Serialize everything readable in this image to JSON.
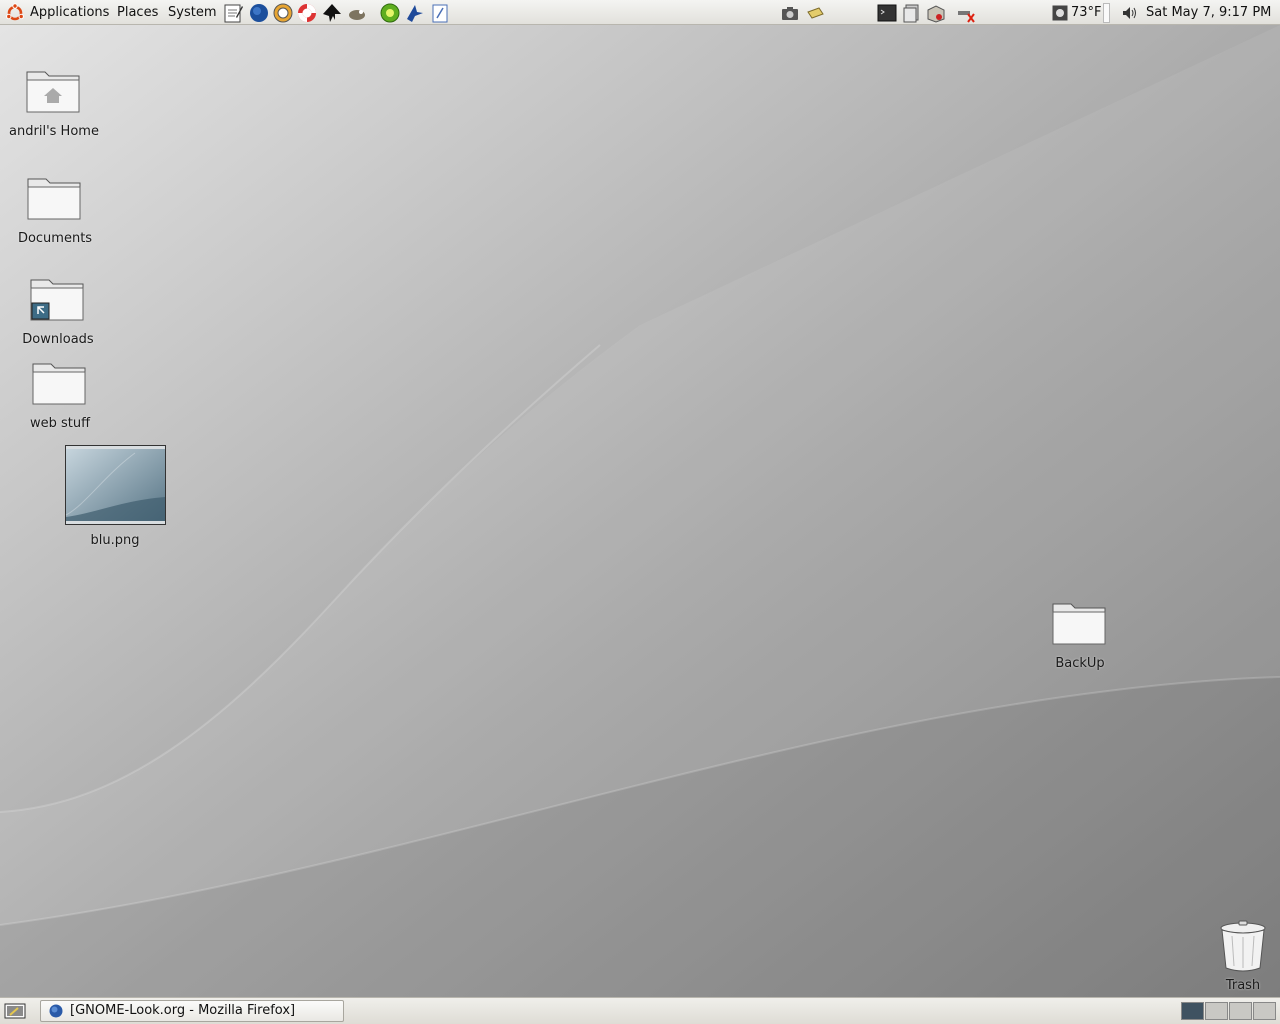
{
  "top_panel": {
    "menus": {
      "applications": "Applications",
      "places": "Places",
      "system": "System"
    },
    "launchers": [
      "text-editor-icon",
      "firefox-globe-icon",
      "gftp-icon",
      "help-lifebuoy-icon",
      "inkscape-icon",
      "gimp-icon",
      "azureus-icon",
      "thunderbird-icon",
      "openoffice-writer-icon"
    ],
    "tray": [
      "camera-icon",
      "notes-icon",
      "terminal-icon",
      "file-manager-icon",
      "package-icon",
      "network-disconnected-icon"
    ],
    "weather_temp": "73°F",
    "clock": "Sat May  7,  9:17 PM"
  },
  "desktop": {
    "icons": {
      "home": "andril's Home",
      "documents": "Documents",
      "downloads": "Downloads",
      "web_stuff": "web stuff",
      "blu": "blu.png",
      "backup": "BackUp",
      "trash": "Trash"
    }
  },
  "bottom_panel": {
    "task_window": "[GNOME-Look.org - Mozilla Firefox]",
    "workspaces": 4,
    "active_workspace": 1
  },
  "colors": {
    "panel": "#e8e7e2",
    "wallpaper_light": "#e2e2e2",
    "wallpaper_dark": "#858585",
    "workspace_active": "#3f5261"
  }
}
